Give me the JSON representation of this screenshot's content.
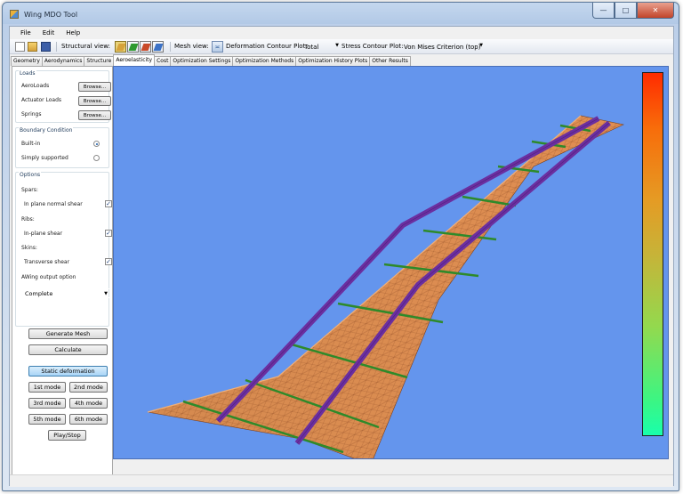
{
  "window": {
    "title": "Wing MDO Tool"
  },
  "menu": [
    "File",
    "Edit",
    "Help"
  ],
  "toolbar": {
    "structural_view_label": "Structural view:",
    "mesh_view_label": "Mesh view:",
    "deformation_label": "Deformation Contour Plot:",
    "deformation_value": "Total",
    "stress_label": "Stress Contour Plot:",
    "stress_value": "Von Mises Criterion (top)"
  },
  "tabs": [
    "Geometry",
    "Aerodynamics",
    "Structure",
    "Aeroelasticity",
    "Cost",
    "Optimization Settings",
    "Optimization Methods",
    "Optimization History Plots",
    "Other Results"
  ],
  "active_tab": "Aeroelasticity",
  "loads": {
    "title": "Loads",
    "rows": [
      {
        "label": "AeroLoads",
        "button": "Browse..."
      },
      {
        "label": "Actuator Loads",
        "button": "Browse..."
      },
      {
        "label": "Springs",
        "button": "Browse..."
      }
    ]
  },
  "boundary": {
    "title": "Boundary Condition",
    "options": [
      {
        "label": "Built-in",
        "checked": true
      },
      {
        "label": "Simply supported",
        "checked": false
      }
    ]
  },
  "options": {
    "title": "Options",
    "spars_label": "Spars:",
    "spars_opt": "In plane normal shear",
    "ribs_label": "Ribs:",
    "ribs_opt": "In-plane shear",
    "skins_label": "Skins:",
    "skins_opt": "Transverse shear",
    "awing_label": "AWing output option",
    "awing_value": "Complete"
  },
  "actions": {
    "generate_mesh": "Generate Mesh",
    "calculate": "Calculate",
    "static_deformation": "Static deformation",
    "mode1": "1st mode",
    "mode2": "2nd mode",
    "mode3": "3rd mode",
    "mode4": "4th mode",
    "mode5": "5th mode",
    "mode6": "6th mode",
    "play_stop": "Play/Stop"
  },
  "colors": {
    "viewport_bg": "#6495ed",
    "wing_surface": "#d98a4e",
    "spar": "#6b2fa0",
    "rib": "#2e8a2a"
  }
}
